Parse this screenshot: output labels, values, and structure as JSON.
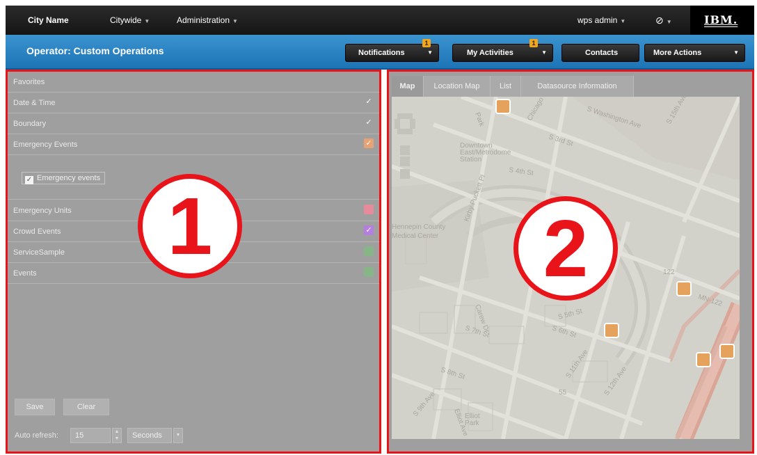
{
  "topnav": {
    "city": "City Name",
    "menu1": "Citywide",
    "menu2": "Administration",
    "user": "wps admin",
    "help": "⍰",
    "logo": "IBM."
  },
  "header": {
    "title": "Operator: Custom Operations",
    "buttons": [
      {
        "label": "Notifications",
        "badge": "1"
      },
      {
        "label": "My Activities",
        "badge": "1"
      },
      {
        "label": "Contacts"
      },
      {
        "label": "More Actions"
      }
    ]
  },
  "layers": {
    "items": [
      {
        "label": "Favorites",
        "checked": false,
        "color": ""
      },
      {
        "label": "Date & Time",
        "checked": true,
        "color": ""
      },
      {
        "label": "Boundary",
        "checked": true,
        "color": ""
      },
      {
        "label": "Emergency Events",
        "checked": true,
        "color": "#e9a273"
      },
      {
        "label": "Emergency Units",
        "checked": false,
        "color": "#e78a9b"
      },
      {
        "label": "Crowd Events",
        "checked": true,
        "color": "#b57fe0"
      },
      {
        "label": "ServiceSample",
        "checked": false,
        "color": "#88b587"
      },
      {
        "label": "Events",
        "checked": false,
        "color": "#88b587"
      }
    ],
    "sub_filter": "Emergency events",
    "save": "Save",
    "clear": "Clear",
    "refresh_label": "Auto refresh:",
    "refresh_value": "15",
    "refresh_unit": "Seconds"
  },
  "map_tabs": [
    "Map",
    "Location Map",
    "List",
    "Datasource Information"
  ],
  "map": {
    "streets": [
      "S Washington Ave",
      "S 3rd St",
      "S 4th St",
      "Kirby Puckett Pl",
      "Park",
      "Chicago",
      "Portland",
      "Downtown East/Metrodome Station",
      "Carew Dr",
      "S 5th St",
      "S 6th St",
      "S 7th St",
      "S 8th St",
      "S 9th Ave",
      "Elliot Ave",
      "S 11th Ave",
      "S 12th Ave",
      "S 15th Ave",
      "MN-122",
      "122",
      "55",
      "Elliot Park",
      "Hennepin County Medical Center"
    ]
  },
  "annotations": {
    "one": "1",
    "two": "2"
  },
  "colors": {
    "accent_red": "#e8141a",
    "header_blue": "#1d74b6",
    "badge": "#f2a51a"
  }
}
